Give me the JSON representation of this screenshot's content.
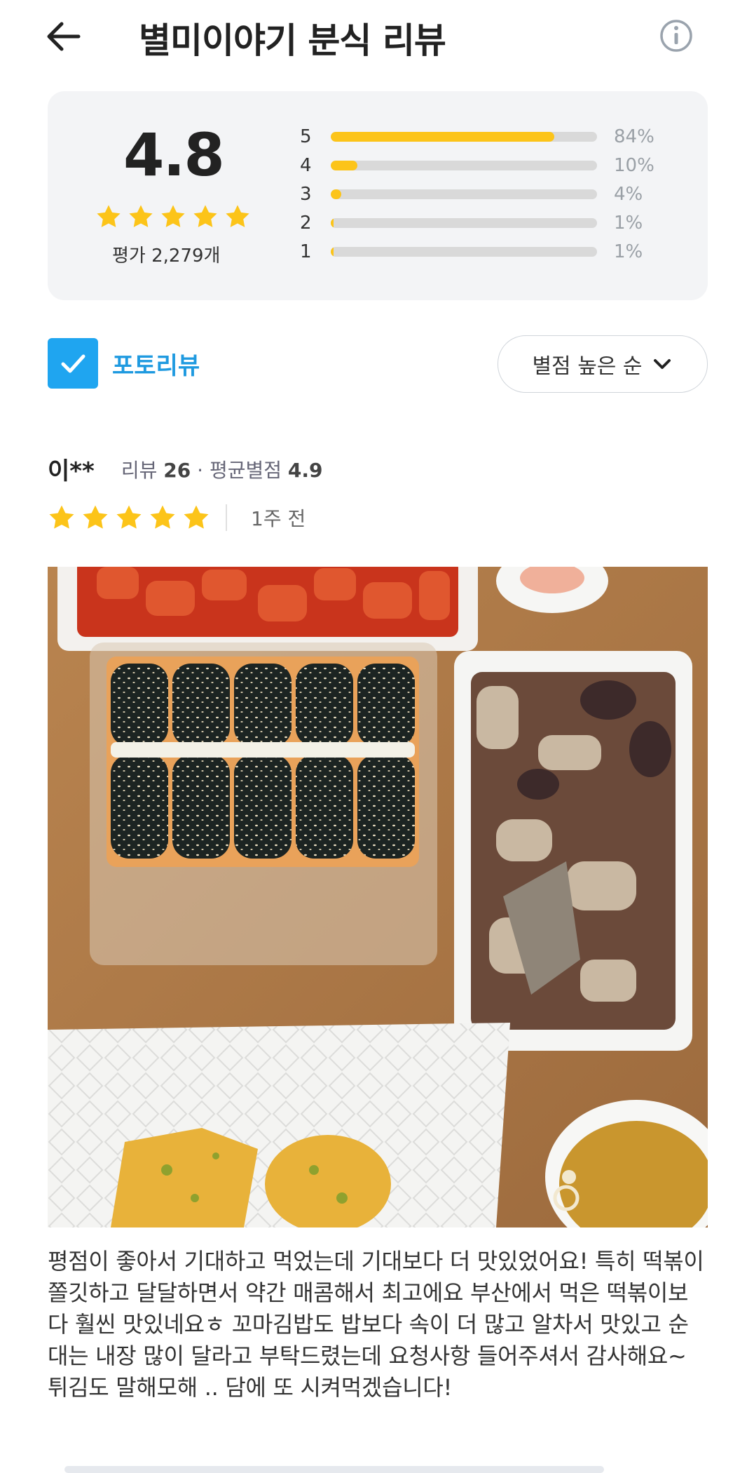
{
  "header": {
    "title": "별미이야기 분식 리뷰",
    "back_icon": "arrow-left-icon",
    "info_icon": "info-circle-icon"
  },
  "summary": {
    "average": "4.8",
    "total_label": "평가 2,279개",
    "distribution": [
      {
        "star": "5",
        "percent_label": "84%",
        "percent": 84
      },
      {
        "star": "4",
        "percent_label": "10%",
        "percent": 10
      },
      {
        "star": "3",
        "percent_label": "4%",
        "percent": 4
      },
      {
        "star": "2",
        "percent_label": "1%",
        "percent": 1
      },
      {
        "star": "1",
        "percent_label": "1%",
        "percent": 1
      }
    ],
    "star_color": "#fcc419"
  },
  "filters": {
    "photo_review_label": "포토리뷰",
    "photo_review_checked": true,
    "sort_label": "별점 높은 순",
    "accent": "#1fa5f0"
  },
  "review": {
    "author": "이**",
    "review_count_label": "리뷰",
    "review_count": "26",
    "avg_label": "· 평균별점",
    "avg_rating": "4.9",
    "rating": 5,
    "date": "1주 전",
    "photo_alt": "food-photo",
    "text": "평점이 좋아서 기대하고 먹었는데 기대보다 더 맛있었어요! 특히 떡볶이 쫄깃하고 달달하면서 약간 매콤해서 최고에요 부산에서 먹은 떡볶이보다 훨씬 맛있네요ㅎ 꼬마김밥도 밥보다 속이 더 많고 알차서 맛있고 순대는 내장 많이 달라고 부탁드렸는데 요청사항 들어주셔서 감사해요~ 튀김도 말해모해 .. 담에 또 시켜먹겠습니다!"
  }
}
